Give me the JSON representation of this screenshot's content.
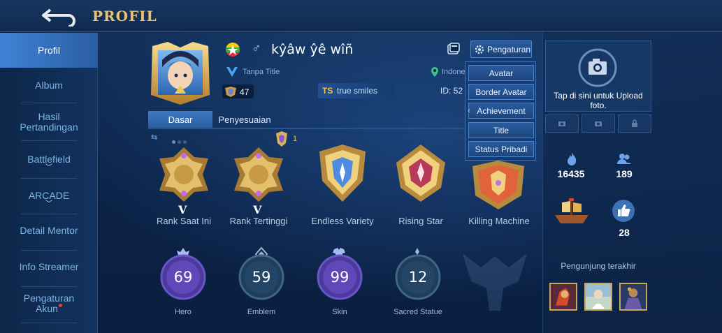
{
  "header": {
    "back_icon": "back-arrow-icon",
    "title": "PROFIL"
  },
  "sidebar": {
    "items": [
      {
        "label": "Profil",
        "active": true
      },
      {
        "label": "Album"
      },
      {
        "label": "Hasil Pertandingan"
      },
      {
        "label": "Battlefield",
        "chevron": "﹀"
      },
      {
        "label": "ARCADE",
        "chevron": "﹀"
      },
      {
        "label": "Detail Mentor"
      },
      {
        "label": "Info Streamer"
      },
      {
        "label": "Pengaturan Akun",
        "notification": true
      }
    ]
  },
  "profile": {
    "gender_symbol": "♂",
    "name": "kŷâw ŷê wîñ",
    "title": "Tanpa Title",
    "level": "47",
    "squad_tag": "TS",
    "squad_name": "true smiles",
    "location": "Indonesia",
    "id_text": "ID: 52",
    "settings_label": "Pengaturan"
  },
  "dropdown": {
    "items": [
      "Avatar",
      "Border Avatar",
      "Achievement",
      "Title",
      "Status Pribadi"
    ],
    "arrow": "‹"
  },
  "tabs": [
    "Dasar",
    "Penyesuaian"
  ],
  "badge_count": "1",
  "achievements": [
    {
      "label": "Rank Saat Ini",
      "roman": "V"
    },
    {
      "label": "Rank Tertinggi",
      "roman": "V"
    },
    {
      "label": "Endless Variety"
    },
    {
      "label": "Rising Star"
    },
    {
      "label": "Killing Machine"
    }
  ],
  "stats_rings": [
    {
      "label": "Hero",
      "value": "69",
      "icon": "hero-icon"
    },
    {
      "label": "Emblem",
      "value": "59",
      "icon": "emblem-icon"
    },
    {
      "label": "Skin",
      "value": "99",
      "icon": "skin-icon"
    },
    {
      "label": "Sacred Statue",
      "value": "12",
      "icon": "statue-icon"
    }
  ],
  "right": {
    "upload_text": "Tap di sini untuk Upload foto.",
    "popularity": "16435",
    "followers": "189",
    "likes": "28",
    "visitors_label": "Pengunjung terakhir"
  },
  "colors": {
    "accent_gold": "#e8c26e",
    "active_blue": "#3f83d4",
    "background": "#0c2447"
  }
}
